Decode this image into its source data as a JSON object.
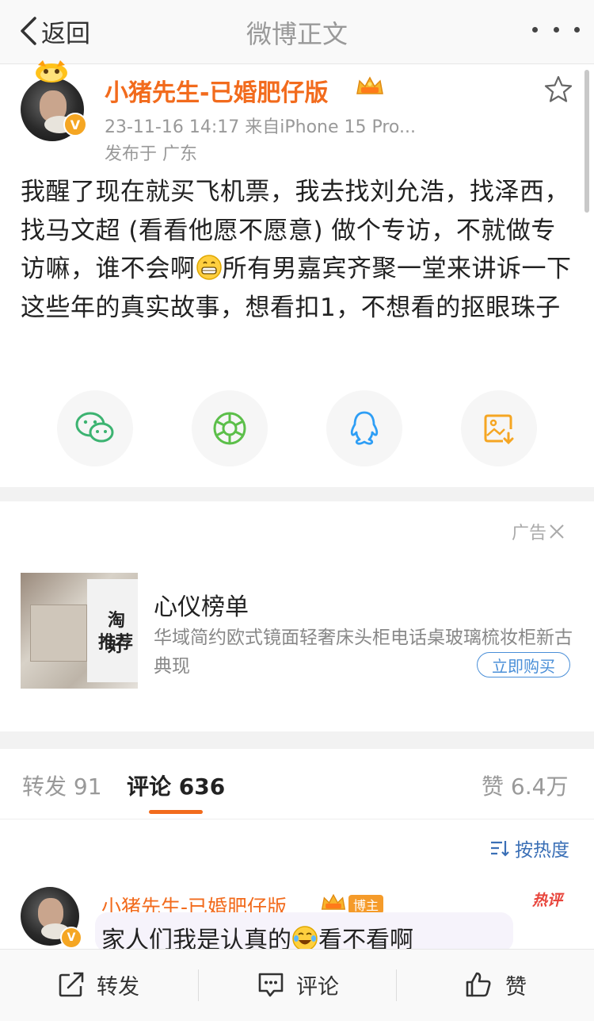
{
  "nav": {
    "back_label": "返回",
    "title": "微博正文"
  },
  "post": {
    "username": "小猪先生-已婚肥仔版",
    "meta": "23-11-16 14:17  来自iPhone 15 Pro...",
    "location": "发布于 广东",
    "text_parts": [
      "我醒了现在就买飞机票，我去找刘允浩，找泽西，找马文超 (看看他愿不愿意) 做个专访，不就做专访嘛，谁不会啊",
      "所有男嘉宾齐聚一堂来讲诉一下这些年的真实故事，想看扣1，不想看的抠眼珠子"
    ],
    "verified_mark": "V"
  },
  "share": {
    "icons": [
      "wechat-icon",
      "moments-icon",
      "qq-icon",
      "save-image-icon"
    ],
    "colors": {
      "wechat": "#3cb371",
      "moments": "#5cbf4a",
      "qq": "#2e9ef5",
      "save": "#f5a623"
    }
  },
  "ad": {
    "tag": "广告",
    "image_text_1": "淘好",
    "image_text_2": "推荐",
    "title": "心仪榜单",
    "description": "华域简约欧式镜面轻奢床头柜电话桌玻璃梳妆柜新古典现",
    "buy_label": "立即购买"
  },
  "tabs": {
    "repost_label": "转发",
    "repost_count": "91",
    "comment_label": "评论",
    "comment_count": "636",
    "like_label": "赞",
    "like_count": "6.4万",
    "active": "comment"
  },
  "sort": {
    "label": "按热度"
  },
  "comments": [
    {
      "username": "小猪先生-已婚肥仔版",
      "owner_badge": "博主",
      "hot_tag": "热评",
      "text": "家人们我是认真的",
      "text_suffix": "看不看啊"
    }
  ],
  "bottom_bar": {
    "repost_label": "转发",
    "comment_label": "评论",
    "like_label": "赞"
  },
  "theme": {
    "accent": "#f26b1d",
    "link": "#3a6fb6"
  }
}
